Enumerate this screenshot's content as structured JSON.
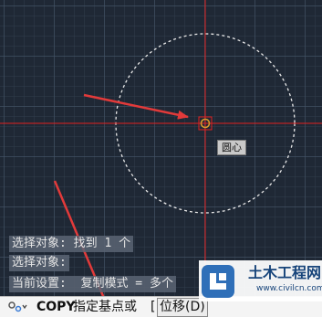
{
  "canvas": {
    "tooltip_label": "圆心",
    "colors": {
      "background": "#1f2835",
      "crosshair": "#e02020",
      "circle": "#e8e8e8",
      "snap_marker": "#d99a2b",
      "annotation_arrow": "#e23a3a"
    }
  },
  "command_history": [
    "选择对象: 找到 1 个",
    "选择对象:",
    "当前设置:  复制模式 = 多个"
  ],
  "command_line": {
    "icon": "command-line-icon",
    "command": "COPY",
    "prompt": "指定基点或",
    "bracket": "[",
    "option": "位移(D)"
  },
  "watermark": {
    "logo_icon": "civilcn-logo-icon",
    "title": "土木工程网",
    "url": "www.civilcn.com"
  }
}
